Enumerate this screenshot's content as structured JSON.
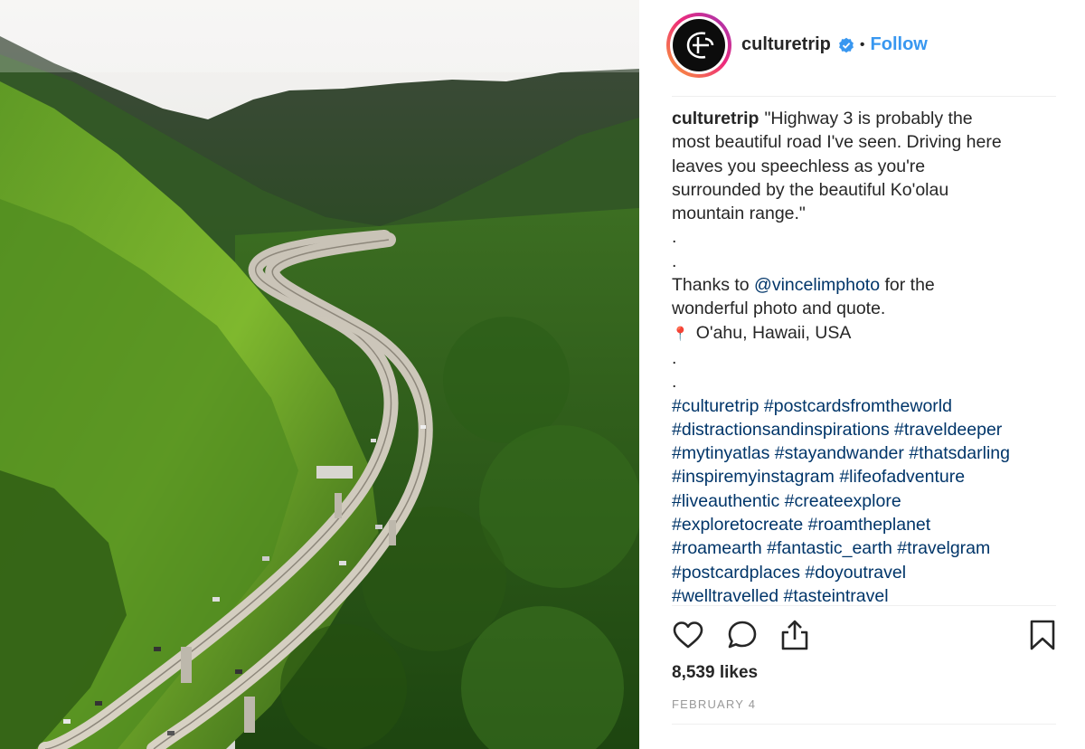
{
  "post": {
    "username": "culturetrip",
    "verified": true,
    "follow_label": "Follow",
    "separator": "•",
    "caption": {
      "username": "culturetrip",
      "quote_lines": [
        "\"Highway 3 is probably the",
        "most beautiful road I've seen. Driving here",
        "leaves you speechless as you're",
        "surrounded by the beautiful Ko'olau",
        "mountain range.\""
      ],
      "spacer_dots": [
        ".",
        "."
      ],
      "thanks_prefix": "Thanks to ",
      "thanks_mention": "@vincelimphoto",
      "thanks_suffix": " for the",
      "thanks_line2": "wonderful photo and quote.",
      "location_icon": "pin-icon",
      "location": "O'ahu, Hawaii, USA",
      "spacer_dots2": [
        ".",
        "."
      ],
      "hashtag_lines": [
        "#culturetrip #postcardsfromtheworld",
        "#distractionsandinspirations #traveldeeper",
        "#mytinyatlas #stayandwander #thatsdarling",
        "#inspiremyinstagram #lifeofadventure",
        "#liveauthentic #createexplore",
        "#exploretocreate #roamtheplanet",
        "#roamearth #fantastic_earth #travelgram",
        "#postcardplaces #doyoutravel",
        "#welltravelled #tasteintravel"
      ]
    },
    "likes": "8,539 likes",
    "date": "FEBRUARY 4",
    "icons": {
      "like": "heart-icon",
      "comment": "comment-icon",
      "share": "share-icon",
      "save": "bookmark-icon"
    },
    "colors": {
      "link": "#3897f0",
      "hashtag": "#003569",
      "verified": "#3897f0"
    }
  }
}
